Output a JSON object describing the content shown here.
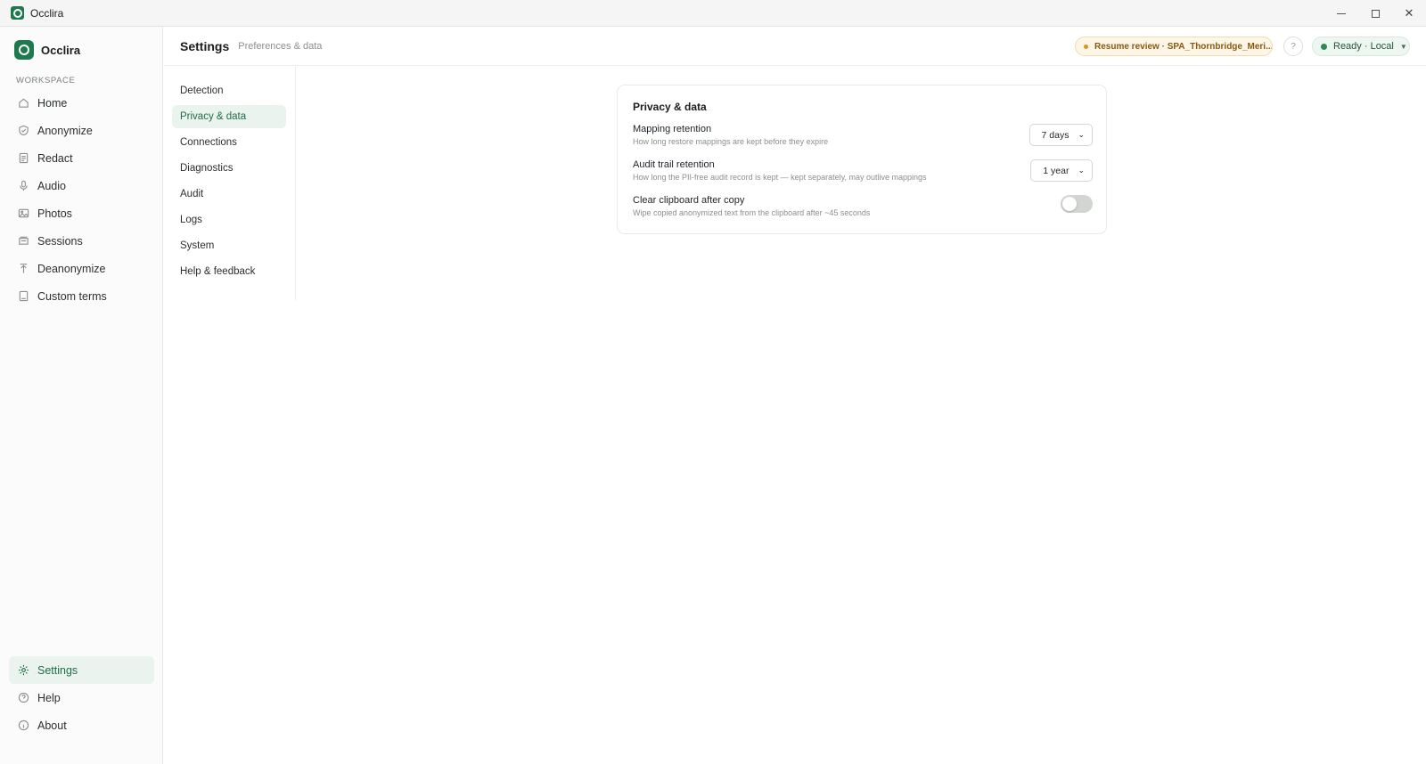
{
  "window": {
    "title": "Occlira"
  },
  "sidebar": {
    "brand": "Occlira",
    "section_label": "WORKSPACE",
    "items": [
      {
        "label": "Home",
        "icon": "home-icon"
      },
      {
        "label": "Anonymize",
        "icon": "shield-icon"
      },
      {
        "label": "Redact",
        "icon": "document-icon"
      },
      {
        "label": "Audio",
        "icon": "microphone-icon"
      },
      {
        "label": "Photos",
        "icon": "image-icon"
      },
      {
        "label": "Sessions",
        "icon": "stack-icon"
      },
      {
        "label": "Deanonymize",
        "icon": "unlock-icon"
      },
      {
        "label": "Custom terms",
        "icon": "book-icon"
      }
    ],
    "bottom_items": [
      {
        "label": "Settings",
        "icon": "gear-icon",
        "active": true
      },
      {
        "label": "Help",
        "icon": "help-icon"
      },
      {
        "label": "About",
        "icon": "info-icon"
      }
    ]
  },
  "header": {
    "title": "Settings",
    "subtitle": "Preferences & data",
    "resume_label": "Resume review · SPA_Thornbridge_Meri...",
    "status_label": "Ready · Local"
  },
  "subnav": {
    "items": [
      "Detection",
      "Privacy & data",
      "Connections",
      "Diagnostics",
      "Audit",
      "Logs",
      "System",
      "Help & feedback"
    ],
    "active_index": 1
  },
  "card": {
    "title": "Privacy & data",
    "rows": [
      {
        "label": "Mapping retention",
        "desc": "How long restore mappings are kept before they expire",
        "control": "select",
        "value": "7 days"
      },
      {
        "label": "Audit trail retention",
        "desc": "How long the PII-free audit record is kept — kept separately, may outlive mappings",
        "control": "select",
        "value": "1 year"
      },
      {
        "label": "Clear clipboard after copy",
        "desc": "Wipe copied anonymized text from the clipboard after ~45 seconds",
        "control": "toggle",
        "value": false
      }
    ]
  },
  "colors": {
    "accent": "#1e7a4c",
    "warning": "#d9961e"
  }
}
